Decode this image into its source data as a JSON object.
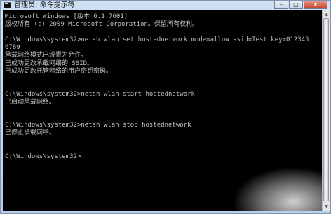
{
  "window": {
    "title": "管理员: 命令提示符",
    "buttons": {
      "minimize": "–",
      "maximize": "□",
      "close": "x"
    }
  },
  "console": {
    "lines": [
      "Microsoft Windows [版本 6.1.7601]",
      "版权所有 (c) 2009 Microsoft Corporation。保留所有权利。",
      "",
      "C:\\Windows\\system32>netsh wlan set hostednetwork mode=allow ssid=Test key=012345",
      "6789",
      "承载网络模式已设置为允许。",
      "已成功更改承载网络的 SSID。",
      "已成功更改托管网络的用户密钥密码。",
      "",
      "",
      "C:\\Windows\\system32>netsh wlan start hostednetwork",
      "已启动承载网络。",
      "",
      "",
      "C:\\Windows\\system32>netsh wlan stop hostednetwork",
      "已停止承载网络。",
      "",
      "",
      "C:\\Windows\\system32>"
    ],
    "text_color": "#c0c0c0",
    "background": "#000000"
  },
  "scrollbar": {
    "up_arrow_icon": "triangle-up",
    "down_arrow_icon": "triangle-down"
  }
}
